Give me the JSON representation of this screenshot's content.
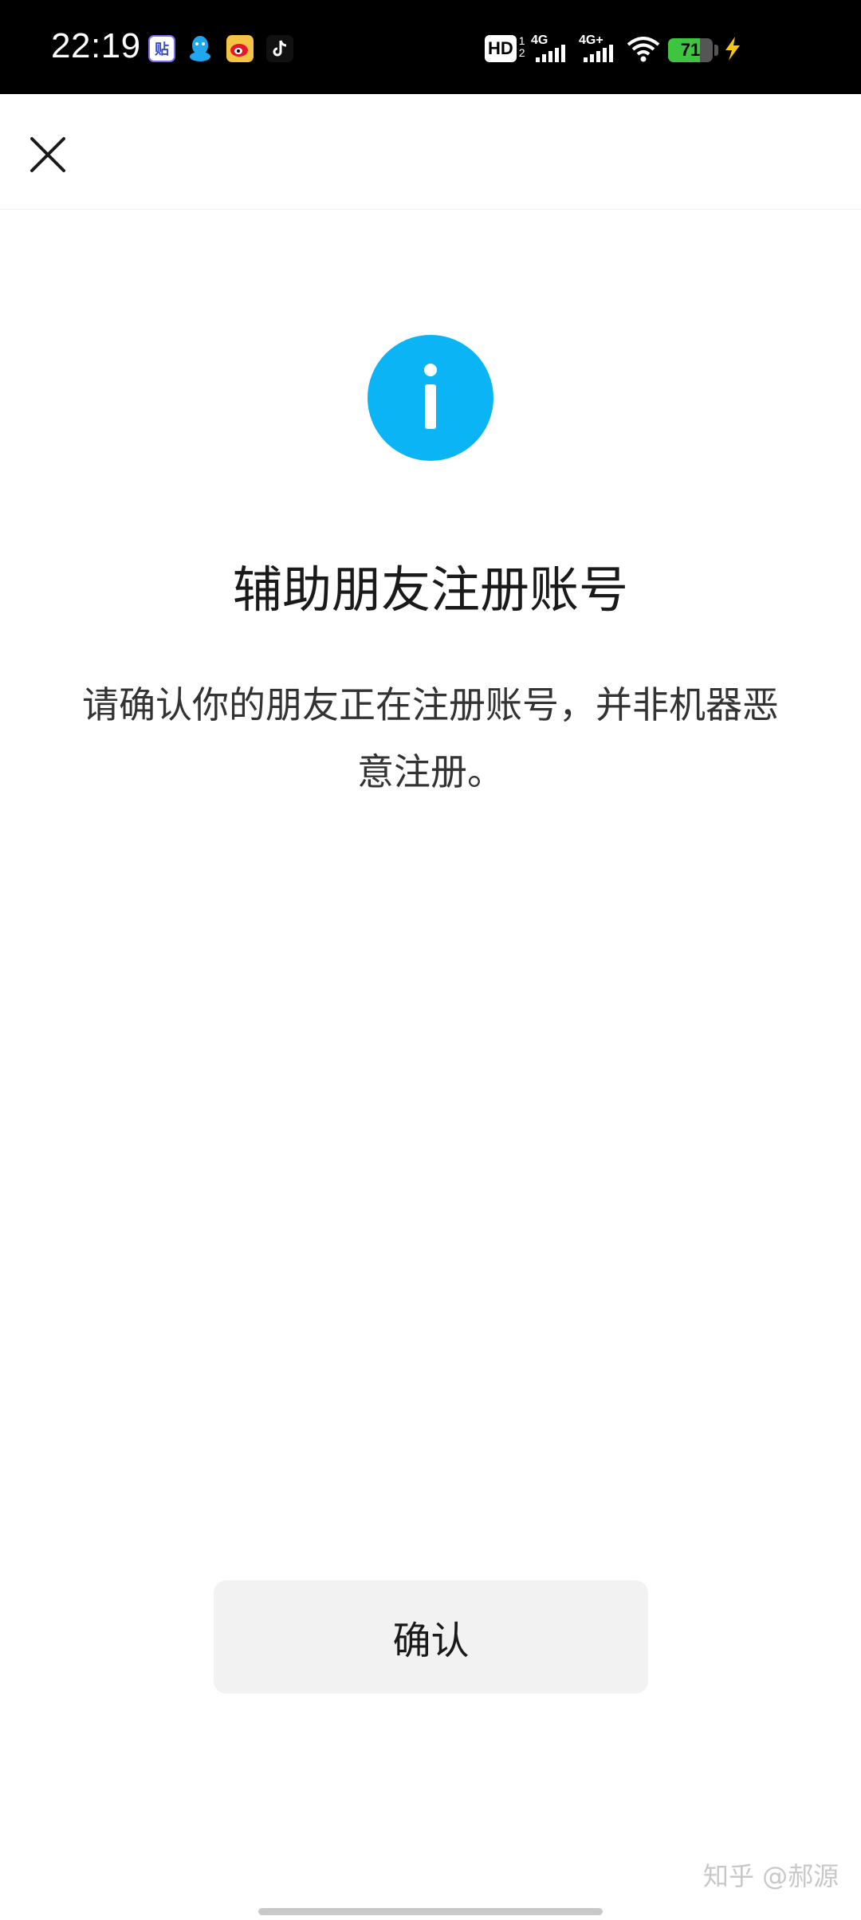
{
  "status_bar": {
    "time": "22:19",
    "app_icons": [
      "tieba-icon",
      "qq-icon",
      "weibo-icon",
      "tiktok-icon"
    ],
    "tieba_glyph": "贴",
    "hd_label": "HD",
    "hd_sub_top": "1",
    "hd_sub_bottom": "2",
    "network_1": "4G",
    "network_2": "4G+",
    "battery_percent": "71",
    "battery_level": 0.71,
    "charging": true
  },
  "nav": {
    "close_icon": "close-icon"
  },
  "main": {
    "icon": "info-icon",
    "icon_color": "#0bb5f5",
    "title": "辅助朋友注册账号",
    "description": "请确认你的朋友正在注册账号，并非机器恶意注册。",
    "confirm_label": "确认"
  },
  "watermark": "知乎 @郝源"
}
